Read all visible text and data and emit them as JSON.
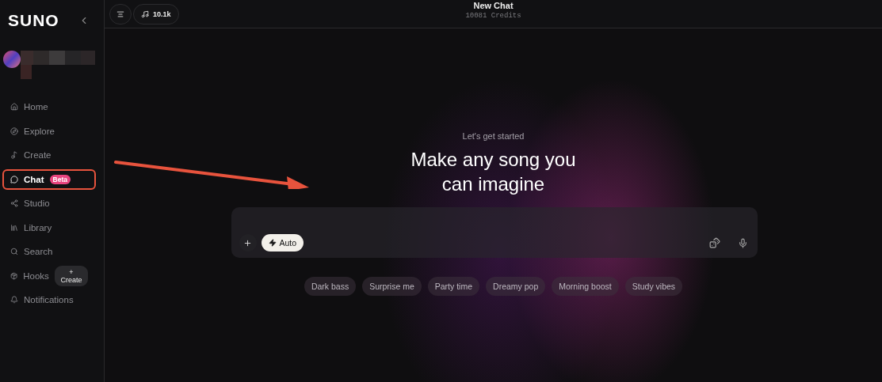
{
  "sidebar": {
    "logo": "SUNO",
    "nav": [
      {
        "label": "Home",
        "selected": false,
        "highlighted": false
      },
      {
        "label": "Explore",
        "selected": false,
        "highlighted": false
      },
      {
        "label": "Create",
        "selected": false,
        "highlighted": false
      },
      {
        "label": "Chat",
        "selected": true,
        "highlighted": true,
        "badge": "Beta"
      },
      {
        "label": "Studio",
        "selected": false,
        "highlighted": false
      },
      {
        "label": "Library",
        "selected": false,
        "highlighted": false
      },
      {
        "label": "Search",
        "selected": false,
        "highlighted": false
      },
      {
        "label": "Hooks",
        "selected": false,
        "highlighted": false,
        "action": "+ Create"
      },
      {
        "label": "Notifications",
        "selected": false,
        "highlighted": false
      }
    ]
  },
  "topbar": {
    "credits_chip": "10.1k",
    "title": "New Chat",
    "subtitle": "10081 Credits"
  },
  "hero": {
    "eyebrow": "Let's get started",
    "heading": "Make any song you can imagine"
  },
  "composer": {
    "mode": "Auto"
  },
  "suggestions": [
    "Dark bass",
    "Surprise me",
    "Party time",
    "Dreamy pop",
    "Morning boost",
    "Study vibes"
  ]
}
